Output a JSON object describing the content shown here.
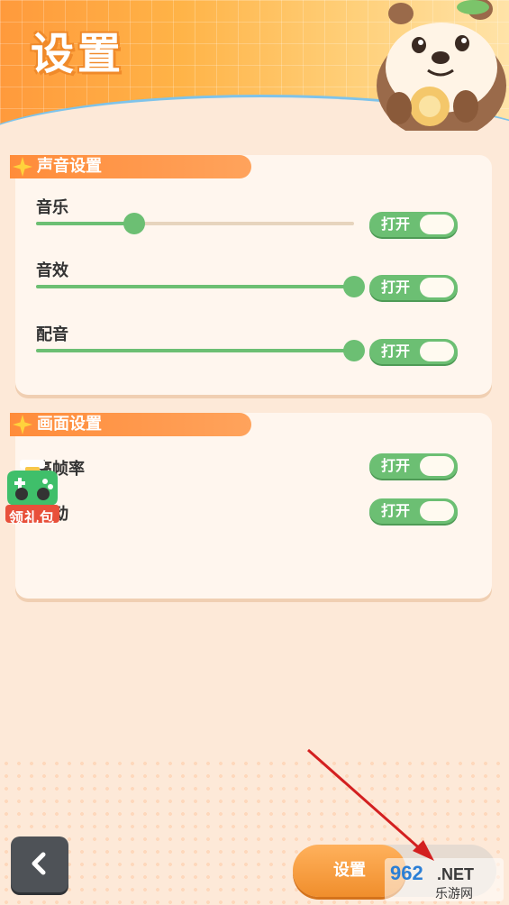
{
  "header": {
    "title": "设置"
  },
  "sound_section": {
    "title": "声音设置",
    "rows": [
      {
        "label": "音乐",
        "level": 0.31,
        "toggle": "打开"
      },
      {
        "label": "音效",
        "level": 1.0,
        "toggle": "打开"
      },
      {
        "label": "配音",
        "level": 1.0,
        "toggle": "打开"
      }
    ]
  },
  "screen_section": {
    "title": "画面设置",
    "rows": [
      {
        "label": "高帧率",
        "toggle": "打开"
      },
      {
        "label": "震动",
        "toggle": "打开"
      }
    ]
  },
  "badge": {
    "text": "领礼包"
  },
  "bottom": {
    "settings_tab": "设置",
    "watermark": "962.NET 乐游网"
  },
  "colors": {
    "accent_orange": "#ff8c3a",
    "toggle_green": "#6cbf73",
    "background": "#fde9d8",
    "annotation_arrow": "#d32020"
  },
  "icons": [
    "star-icon",
    "otter-mascot",
    "gamepad-icon",
    "back-arrow-icon"
  ]
}
